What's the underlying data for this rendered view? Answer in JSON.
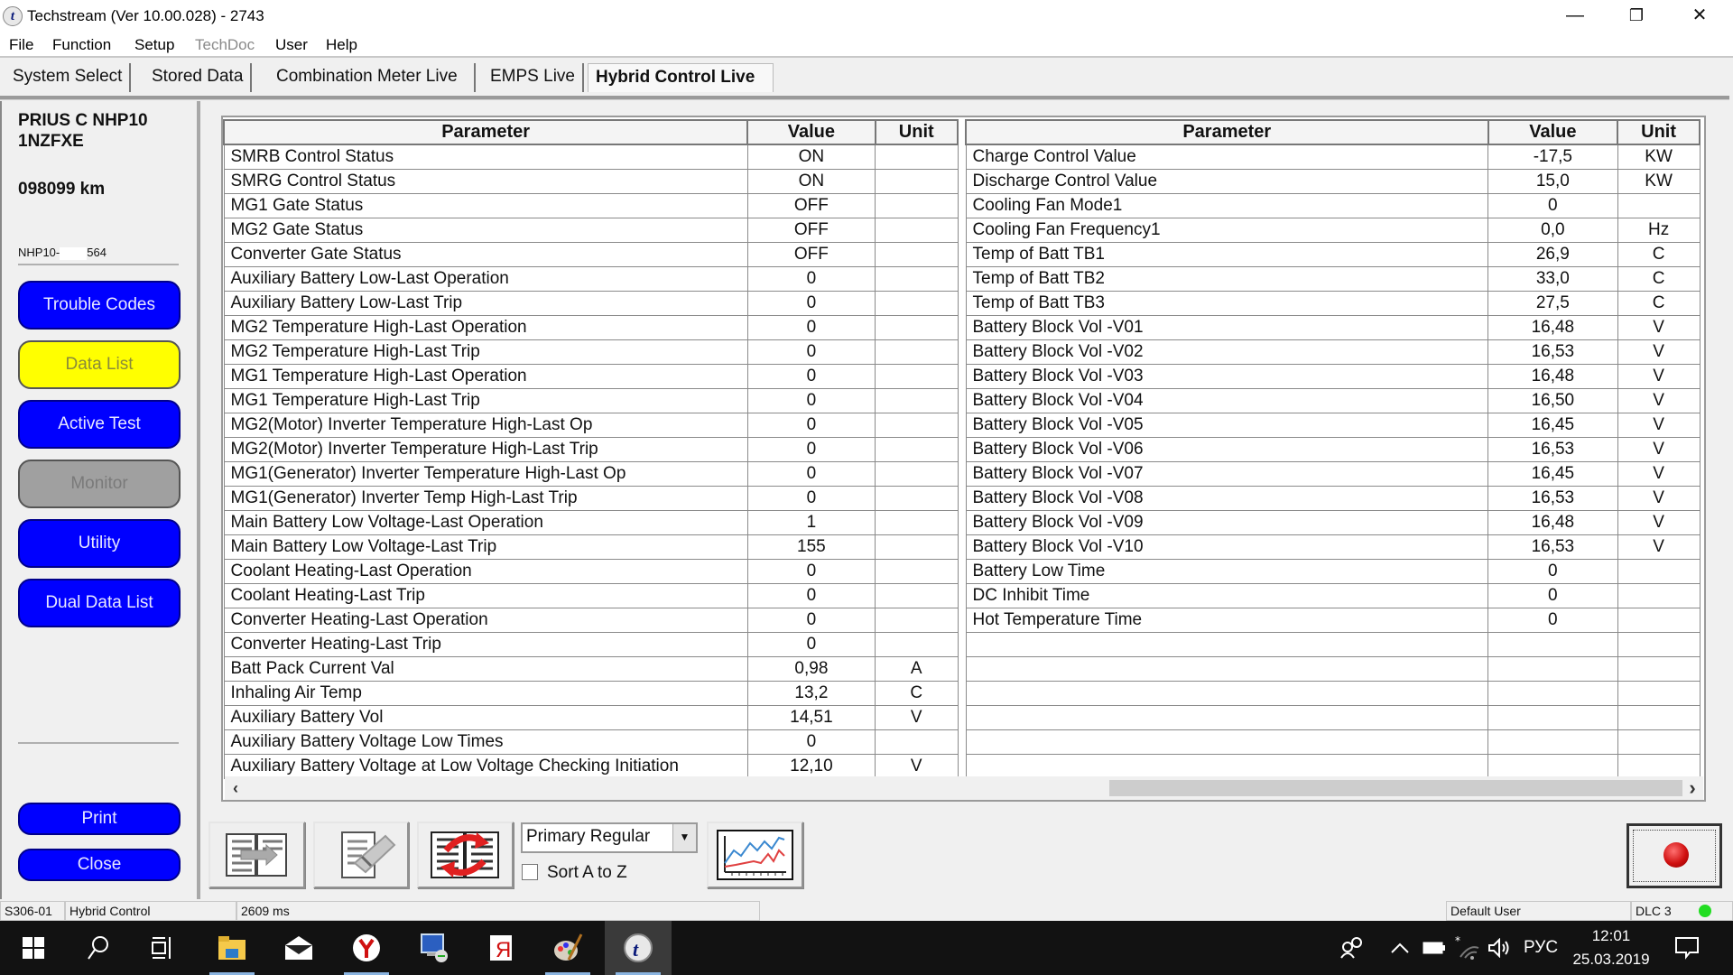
{
  "window": {
    "title": "Techstream (Ver 10.00.028) - 2743",
    "app_icon_glyph": "t",
    "minimize_glyph": "—",
    "restore_glyph": "❐",
    "close_glyph": "✕"
  },
  "menu": [
    "File",
    "Function",
    "Setup",
    "TechDoc",
    "User",
    "Help"
  ],
  "tabs": [
    {
      "label": "System Select",
      "active": false
    },
    {
      "label": "Stored Data",
      "active": false
    },
    {
      "label": "Combination Meter Live",
      "active": false
    },
    {
      "label": "EMPS Live",
      "active": false
    },
    {
      "label": "Hybrid Control Live",
      "active": true
    }
  ],
  "vehicle": {
    "model_line1": "PRIUS C NHP10",
    "model_line2": "1NZFXE",
    "odometer": "098099 km",
    "vin_prefix": "NHP10-",
    "vin_suffix": "564"
  },
  "sidebar": {
    "buttons": [
      {
        "label": "Trouble Codes",
        "state": "normal"
      },
      {
        "label": "Data List",
        "state": "selected"
      },
      {
        "label": "Active Test",
        "state": "normal"
      },
      {
        "label": "Monitor",
        "state": "disabled"
      },
      {
        "label": "Utility",
        "state": "normal"
      },
      {
        "label": "Dual Data List",
        "state": "normal"
      }
    ],
    "print_label": "Print",
    "close_label": "Close"
  },
  "table_left": {
    "headers": [
      "Parameter",
      "Value",
      "Unit"
    ],
    "rows": [
      [
        "SMRB Control Status",
        "ON",
        ""
      ],
      [
        "SMRG Control Status",
        "ON",
        ""
      ],
      [
        "MG1 Gate Status",
        "OFF",
        ""
      ],
      [
        "MG2 Gate Status",
        "OFF",
        ""
      ],
      [
        "Converter Gate Status",
        "OFF",
        ""
      ],
      [
        "Auxiliary Battery Low-Last Operation",
        "0",
        ""
      ],
      [
        "Auxiliary Battery Low-Last Trip",
        "0",
        ""
      ],
      [
        "MG2 Temperature High-Last Operation",
        "0",
        ""
      ],
      [
        "MG2 Temperature High-Last Trip",
        "0",
        ""
      ],
      [
        "MG1 Temperature High-Last Operation",
        "0",
        ""
      ],
      [
        "MG1 Temperature High-Last Trip",
        "0",
        ""
      ],
      [
        "MG2(Motor) Inverter Temperature High-Last Op",
        "0",
        ""
      ],
      [
        "MG2(Motor) Inverter Temperature High-Last Trip",
        "0",
        ""
      ],
      [
        "MG1(Generator) Inverter Temperature High-Last Op",
        "0",
        ""
      ],
      [
        "MG1(Generator) Inverter Temp High-Last Trip",
        "0",
        ""
      ],
      [
        "Main Battery Low Voltage-Last Operation",
        "1",
        ""
      ],
      [
        "Main Battery Low Voltage-Last Trip",
        "155",
        ""
      ],
      [
        "Coolant Heating-Last Operation",
        "0",
        ""
      ],
      [
        "Coolant Heating-Last Trip",
        "0",
        ""
      ],
      [
        "Converter Heating-Last Operation",
        "0",
        ""
      ],
      [
        "Converter Heating-Last Trip",
        "0",
        ""
      ],
      [
        "Batt Pack Current Val",
        "0,98",
        "A"
      ],
      [
        "Inhaling Air Temp",
        "13,2",
        "C"
      ],
      [
        "Auxiliary Battery Vol",
        "14,51",
        "V"
      ],
      [
        "Auxiliary Battery Voltage Low Times",
        "0",
        ""
      ],
      [
        "Auxiliary Battery Voltage at Low Voltage Checking Initiation",
        "12,10",
        "V"
      ]
    ]
  },
  "table_right": {
    "headers": [
      "Parameter",
      "Value",
      "Unit"
    ],
    "rows": [
      [
        "Charge Control Value",
        "-17,5",
        "KW"
      ],
      [
        "Discharge Control Value",
        "15,0",
        "KW"
      ],
      [
        "Cooling Fan Mode1",
        "0",
        ""
      ],
      [
        "Cooling Fan Frequency1",
        "0,0",
        "Hz"
      ],
      [
        "Temp of Batt TB1",
        "26,9",
        "C"
      ],
      [
        "Temp of Batt TB2",
        "33,0",
        "C"
      ],
      [
        "Temp of Batt TB3",
        "27,5",
        "C"
      ],
      [
        "Battery Block Vol -V01",
        "16,48",
        "V"
      ],
      [
        "Battery Block Vol -V02",
        "16,53",
        "V"
      ],
      [
        "Battery Block Vol -V03",
        "16,48",
        "V"
      ],
      [
        "Battery Block Vol -V04",
        "16,50",
        "V"
      ],
      [
        "Battery Block Vol -V05",
        "16,45",
        "V"
      ],
      [
        "Battery Block Vol -V06",
        "16,53",
        "V"
      ],
      [
        "Battery Block Vol -V07",
        "16,45",
        "V"
      ],
      [
        "Battery Block Vol -V08",
        "16,53",
        "V"
      ],
      [
        "Battery Block Vol -V09",
        "16,48",
        "V"
      ],
      [
        "Battery Block Vol -V10",
        "16,53",
        "V"
      ],
      [
        "Battery Low Time",
        "0",
        ""
      ],
      [
        "DC Inhibit Time",
        "0",
        ""
      ],
      [
        "Hot Temperature Time",
        "0",
        ""
      ],
      [
        "",
        "",
        ""
      ],
      [
        "",
        "",
        ""
      ],
      [
        "",
        "",
        ""
      ],
      [
        "",
        "",
        ""
      ],
      [
        "",
        "",
        ""
      ],
      [
        "",
        "",
        ""
      ]
    ]
  },
  "scrollbar": {
    "left_arrow": "‹",
    "right_arrow": "›"
  },
  "toolbar": {
    "icons": [
      "move-params-icon",
      "erase-list-icon",
      "swap-lists-icon",
      "graph-icon"
    ],
    "dropdown_value": "Primary Regular",
    "dropdown_arrow": "▼",
    "sort_label": "Sort A to Z",
    "sort_checked": false,
    "record_icon": "record-icon"
  },
  "statusbar": {
    "code": "S306-01",
    "system": "Hybrid Control",
    "timing": "2609 ms",
    "user": "Default User",
    "connector": "DLC 3",
    "connection_color": "#22dd22"
  },
  "taskbar": {
    "language": "РУС",
    "time": "12:01",
    "date": "25.03.2019"
  },
  "colors": {
    "button_blue": "#0000ff",
    "button_selected": "#ffff00",
    "button_disabled": "#a0a0a0"
  }
}
